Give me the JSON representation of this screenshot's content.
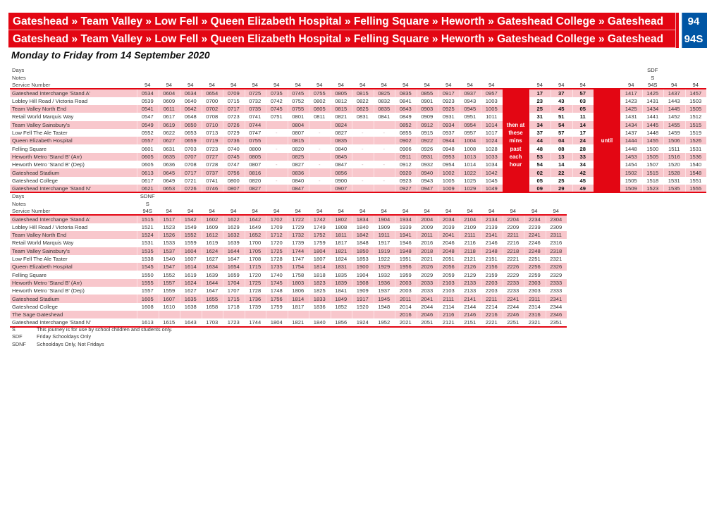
{
  "banners": [
    {
      "route": "Gateshead » Team Valley » Low Fell » Queen Elizabeth Hospital » Felling Square » Heworth » Gateshead College » Gateshead",
      "service": "94"
    },
    {
      "route": "Gateshead » Team Valley » Low Fell » Queen Elizabeth Hospital » Felling Square » Heworth » Gateshead College » Gateshead",
      "service": "94S"
    }
  ],
  "subtitle": "Monday to Friday from 14 September 2020",
  "labels": {
    "days": "Days",
    "notes": "Notes",
    "service_number": "Service Number"
  },
  "colors": {
    "brand_red": "#e30613",
    "brand_blue": "#0055a4",
    "row_pink": "#f8c7cc"
  },
  "table1": {
    "frequency_text": [
      "then at",
      "these",
      "mins",
      "past",
      "each",
      "hour"
    ],
    "until_text": "until",
    "columns": [
      {
        "days": "",
        "notes": "",
        "service": "94"
      },
      {
        "days": "",
        "notes": "",
        "service": "94"
      },
      {
        "days": "",
        "notes": "",
        "service": "94"
      },
      {
        "days": "",
        "notes": "",
        "service": "94"
      },
      {
        "days": "",
        "notes": "",
        "service": "94"
      },
      {
        "days": "",
        "notes": "",
        "service": "94"
      },
      {
        "days": "",
        "notes": "",
        "service": "94"
      },
      {
        "days": "",
        "notes": "",
        "service": "94"
      },
      {
        "days": "",
        "notes": "",
        "service": "94"
      },
      {
        "days": "",
        "notes": "",
        "service": "94"
      },
      {
        "days": "",
        "notes": "",
        "service": "94"
      },
      {
        "days": "",
        "notes": "",
        "service": "94"
      },
      {
        "days": "",
        "notes": "",
        "service": "94"
      },
      {
        "days": "",
        "notes": "",
        "service": "94"
      },
      {
        "days": "",
        "notes": "",
        "service": "94"
      },
      {
        "days": "",
        "notes": "",
        "service": "94"
      },
      {
        "days": "",
        "notes": "",
        "service": "94"
      },
      {
        "type": "freq"
      },
      {
        "days": "",
        "notes": "",
        "service": "94",
        "bold": true
      },
      {
        "days": "",
        "notes": "",
        "service": "94",
        "bold": true
      },
      {
        "days": "",
        "notes": "",
        "service": "94",
        "bold": true
      },
      {
        "type": "until"
      },
      {
        "days": "",
        "notes": "",
        "service": "94"
      },
      {
        "days": "SDF",
        "notes": "S",
        "service": "94S"
      },
      {
        "days": "",
        "notes": "",
        "service": "94"
      },
      {
        "days": "",
        "notes": "",
        "service": "94"
      }
    ],
    "rows": [
      {
        "stop": "Gateshead Interchange 'Stand A'",
        "times": [
          "0534",
          "0604",
          "0634",
          "0654",
          "0709",
          "0725",
          "0735",
          "0745",
          "0755",
          "0805",
          "0815",
          "0825",
          "0835",
          "0855",
          "0917",
          "0937",
          "0957",
          "17",
          "37",
          "57",
          "1417",
          "1425",
          "1437",
          "1457"
        ]
      },
      {
        "stop": "Lobley Hill Road / Victoria Road",
        "times": [
          "0539",
          "0609",
          "0640",
          "0700",
          "0715",
          "0732",
          "0742",
          "0752",
          "0802",
          "0812",
          "0822",
          "0832",
          "0841",
          "0901",
          "0923",
          "0943",
          "1003",
          "23",
          "43",
          "03",
          "1423",
          "1431",
          "1443",
          "1503"
        ]
      },
      {
        "stop": "Team Valley North End",
        "times": [
          "0541",
          "0611",
          "0642",
          "0702",
          "0717",
          "0735",
          "0745",
          "0755",
          "0805",
          "0815",
          "0825",
          "0835",
          "0843",
          "0903",
          "0925",
          "0945",
          "1005",
          "25",
          "45",
          "05",
          "1425",
          "1434",
          "1445",
          "1505"
        ]
      },
      {
        "stop": "Retail World Marquis Way",
        "times": [
          "0547",
          "0617",
          "0648",
          "0708",
          "0723",
          "0741",
          "0751",
          "0801",
          "0811",
          "0821",
          "0831",
          "0841",
          "0849",
          "0909",
          "0931",
          "0951",
          "1011",
          "31",
          "51",
          "11",
          "1431",
          "1441",
          "1452",
          "1512"
        ]
      },
      {
        "stop": "Team Valley Sainsbury's",
        "times": [
          "0549",
          "0619",
          "0650",
          "0710",
          "0726",
          "0744",
          "",
          "0804",
          "",
          "0824",
          "",
          "",
          "0852",
          "0912",
          "0934",
          "0954",
          "1014",
          "34",
          "54",
          "14",
          "1434",
          "1445",
          "1455",
          "1515"
        ]
      },
      {
        "stop": "Low Fell The Ale Taster",
        "times": [
          "0552",
          "0622",
          "0653",
          "0713",
          "0729",
          "0747",
          "-",
          "0807",
          "-",
          "0827",
          "-",
          "-",
          "0855",
          "0915",
          "0937",
          "0957",
          "1017",
          "37",
          "57",
          "17",
          "1437",
          "1448",
          "1459",
          "1519"
        ]
      },
      {
        "stop": "Queen Elizabeth Hospital",
        "times": [
          "0557",
          "0627",
          "0659",
          "0719",
          "0736",
          "0755",
          "",
          "0815",
          "",
          "0835",
          "",
          "",
          "0902",
          "0922",
          "0944",
          "1004",
          "1024",
          "44",
          "04",
          "24",
          "1444",
          "1455",
          "1506",
          "1526"
        ]
      },
      {
        "stop": "Felling Square",
        "times": [
          "0601",
          "0631",
          "0703",
          "0723",
          "0740",
          "0800",
          "-",
          "0820",
          "-",
          "0840",
          "-",
          "-",
          "0906",
          "0926",
          "0948",
          "1008",
          "1028",
          "48",
          "08",
          "28",
          "1448",
          "1500",
          "1511",
          "1531"
        ]
      },
      {
        "stop": "Heworth Metro 'Stand B' (Arr)",
        "times": [
          "0605",
          "0635",
          "0707",
          "0727",
          "0745",
          "0805",
          "",
          "0825",
          "",
          "0845",
          "",
          "",
          "0911",
          "0931",
          "0953",
          "1013",
          "1033",
          "53",
          "13",
          "33",
          "1453",
          "1505",
          "1516",
          "1536"
        ]
      },
      {
        "stop": "Heworth Metro 'Stand B' (Dep)",
        "times": [
          "0605",
          "0636",
          "0708",
          "0728",
          "0747",
          "0807",
          "-",
          "0827",
          "-",
          "0847",
          "-",
          "-",
          "0912",
          "0932",
          "0954",
          "1014",
          "1034",
          "54",
          "14",
          "34",
          "1454",
          "1507",
          "1520",
          "1540"
        ]
      },
      {
        "stop": "Gateshead Stadium",
        "times": [
          "0613",
          "0645",
          "0717",
          "0737",
          "0756",
          "0816",
          "",
          "0836",
          "",
          "0856",
          "",
          "",
          "0920",
          "0940",
          "1002",
          "1022",
          "1042",
          "02",
          "22",
          "42",
          "1502",
          "1515",
          "1528",
          "1548"
        ]
      },
      {
        "stop": "Gateshead College",
        "times": [
          "0617",
          "0649",
          "0721",
          "0741",
          "0800",
          "0820",
          "-",
          "0840",
          "-",
          "0900",
          "-",
          "-",
          "0923",
          "0943",
          "1005",
          "1025",
          "1045",
          "05",
          "25",
          "45",
          "1505",
          "1518",
          "1531",
          "1551"
        ]
      },
      {
        "stop": "Gateshead Interchange 'Stand N'",
        "times": [
          "0621",
          "0653",
          "0726",
          "0746",
          "0807",
          "0827",
          "",
          "0847",
          "",
          "0907",
          "",
          "",
          "0927",
          "0947",
          "1009",
          "1029",
          "1049",
          "09",
          "29",
          "49",
          "1509",
          "1523",
          "1535",
          "1555"
        ]
      }
    ]
  },
  "table2": {
    "columns": [
      {
        "days": "SDNF",
        "notes": "S",
        "service": "94S"
      },
      {
        "days": "",
        "notes": "",
        "service": "94"
      },
      {
        "days": "",
        "notes": "",
        "service": "94"
      },
      {
        "days": "",
        "notes": "",
        "service": "94"
      },
      {
        "days": "",
        "notes": "",
        "service": "94"
      },
      {
        "days": "",
        "notes": "",
        "service": "94"
      },
      {
        "days": "",
        "notes": "",
        "service": "94"
      },
      {
        "days": "",
        "notes": "",
        "service": "94"
      },
      {
        "days": "",
        "notes": "",
        "service": "94"
      },
      {
        "days": "",
        "notes": "",
        "service": "94"
      },
      {
        "days": "",
        "notes": "",
        "service": "94"
      },
      {
        "days": "",
        "notes": "",
        "service": "94"
      },
      {
        "days": "",
        "notes": "",
        "service": "94"
      },
      {
        "days": "",
        "notes": "",
        "service": "94"
      },
      {
        "days": "",
        "notes": "",
        "service": "94"
      },
      {
        "days": "",
        "notes": "",
        "service": "94"
      },
      {
        "days": "",
        "notes": "",
        "service": "94"
      },
      {
        "days": "",
        "notes": "",
        "service": "94"
      },
      {
        "days": "",
        "notes": "",
        "service": "94"
      },
      {
        "days": "",
        "notes": "",
        "service": "94"
      },
      {
        "days": "",
        "notes": "",
        "service": "94"
      }
    ],
    "rows": [
      {
        "stop": "Gateshead Interchange 'Stand A'",
        "times": [
          "1515",
          "1517",
          "1542",
          "1602",
          "1622",
          "1642",
          "1702",
          "1722",
          "1742",
          "1802",
          "1834",
          "1904",
          "1934",
          "2004",
          "2034",
          "2104",
          "2134",
          "2204",
          "2234",
          "2304"
        ]
      },
      {
        "stop": "Lobley Hill Road / Victoria Road",
        "times": [
          "1521",
          "1523",
          "1549",
          "1609",
          "1629",
          "1649",
          "1709",
          "1729",
          "1749",
          "1808",
          "1840",
          "1909",
          "1939",
          "2009",
          "2039",
          "2109",
          "2139",
          "2209",
          "2239",
          "2309"
        ]
      },
      {
        "stop": "Team Valley North End",
        "times": [
          "1524",
          "1526",
          "1552",
          "1612",
          "1632",
          "1652",
          "1712",
          "1732",
          "1752",
          "1811",
          "1842",
          "1911",
          "1941",
          "2011",
          "2041",
          "2111",
          "2141",
          "2211",
          "2241",
          "2311"
        ]
      },
      {
        "stop": "Retail World Marquis Way",
        "times": [
          "1531",
          "1533",
          "1559",
          "1619",
          "1639",
          "1700",
          "1720",
          "1739",
          "1759",
          "1817",
          "1848",
          "1917",
          "1946",
          "2016",
          "2046",
          "2116",
          "2146",
          "2216",
          "2246",
          "2316"
        ]
      },
      {
        "stop": "Team Valley Sainsbury's",
        "times": [
          "1535",
          "1537",
          "1604",
          "1624",
          "1644",
          "1705",
          "1725",
          "1744",
          "1804",
          "1821",
          "1850",
          "1919",
          "1948",
          "2018",
          "2048",
          "2118",
          "2148",
          "2218",
          "2248",
          "2318"
        ]
      },
      {
        "stop": "Low Fell The Ale Taster",
        "times": [
          "1538",
          "1540",
          "1607",
          "1627",
          "1647",
          "1708",
          "1728",
          "1747",
          "1807",
          "1824",
          "1853",
          "1922",
          "1951",
          "2021",
          "2051",
          "2121",
          "2151",
          "2221",
          "2251",
          "2321"
        ]
      },
      {
        "stop": "Queen Elizabeth Hospital",
        "times": [
          "1545",
          "1547",
          "1614",
          "1634",
          "1654",
          "1715",
          "1735",
          "1754",
          "1814",
          "1831",
          "1900",
          "1929",
          "1956",
          "2026",
          "2056",
          "2126",
          "2156",
          "2226",
          "2256",
          "2326"
        ]
      },
      {
        "stop": "Felling Square",
        "times": [
          "1550",
          "1552",
          "1619",
          "1639",
          "1659",
          "1720",
          "1740",
          "1758",
          "1818",
          "1835",
          "1904",
          "1932",
          "1959",
          "2029",
          "2059",
          "2129",
          "2159",
          "2229",
          "2259",
          "2329"
        ]
      },
      {
        "stop": "Heworth Metro 'Stand B' (Arr)",
        "times": [
          "1555",
          "1557",
          "1624",
          "1644",
          "1704",
          "1725",
          "1745",
          "1803",
          "1823",
          "1839",
          "1908",
          "1936",
          "2003",
          "2033",
          "2103",
          "2133",
          "2203",
          "2233",
          "2303",
          "2333"
        ]
      },
      {
        "stop": "Heworth Metro 'Stand B' (Dep)",
        "times": [
          "1557",
          "1559",
          "1627",
          "1647",
          "1707",
          "1728",
          "1748",
          "1806",
          "1825",
          "1841",
          "1909",
          "1937",
          "2003",
          "2033",
          "2103",
          "2133",
          "2203",
          "2233",
          "2303",
          "2333"
        ]
      },
      {
        "stop": "Gateshead Stadium",
        "times": [
          "1605",
          "1607",
          "1635",
          "1655",
          "1715",
          "1736",
          "1756",
          "1814",
          "1833",
          "1849",
          "1917",
          "1945",
          "2011",
          "2041",
          "2111",
          "2141",
          "2211",
          "2241",
          "2311",
          "2341"
        ]
      },
      {
        "stop": "Gateshead College",
        "times": [
          "1608",
          "1610",
          "1638",
          "1658",
          "1718",
          "1739",
          "1759",
          "1817",
          "1836",
          "1852",
          "1920",
          "1948",
          "2014",
          "2044",
          "2114",
          "2144",
          "2214",
          "2244",
          "2314",
          "2344"
        ]
      },
      {
        "stop": "The Sage Gateshead",
        "times": [
          "",
          "",
          "",
          "",
          "",
          "",
          "",
          "",
          "",
          "",
          "",
          "",
          "2016",
          "2046",
          "2116",
          "2146",
          "2216",
          "2246",
          "2316",
          "2346"
        ]
      },
      {
        "stop": "Gateshead Interchange 'Stand N'",
        "times": [
          "1613",
          "1615",
          "1643",
          "1703",
          "1723",
          "1744",
          "1804",
          "1821",
          "1840",
          "1856",
          "1924",
          "1952",
          "2021",
          "2051",
          "2121",
          "2151",
          "2221",
          "2251",
          "2321",
          "2351"
        ]
      }
    ]
  },
  "legend": [
    {
      "code": "S",
      "text": "This journey is for use by school children and students only."
    },
    {
      "code": "SDF",
      "text": "Friday Schooldays Only"
    },
    {
      "code": "SDNF",
      "text": "Schooldays Only, Not Fridays"
    }
  ]
}
